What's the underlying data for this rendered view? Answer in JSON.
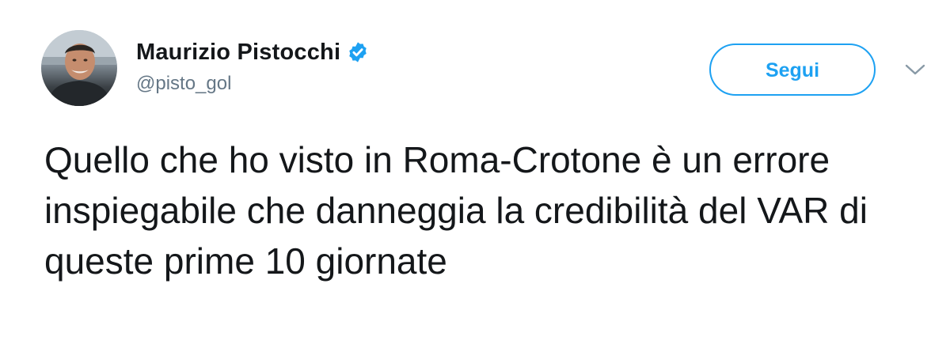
{
  "tweet": {
    "author": {
      "display_name": "Maurizio Pistocchi",
      "handle": "@pisto_gol",
      "verified_icon": "verified-badge-icon",
      "avatar_icon": "avatar"
    },
    "follow_button_label": "Segui",
    "menu_icon": "chevron-down-icon",
    "text": "Quello che ho visto in Roma-Crotone è un errore inspiegabile che danneggia la credibilità del VAR di queste prime 10 giornate"
  },
  "colors": {
    "accent": "#1da1f2",
    "text_primary": "#14171a",
    "text_secondary": "#657786",
    "caret": "#8899a6",
    "background": "#ffffff"
  }
}
